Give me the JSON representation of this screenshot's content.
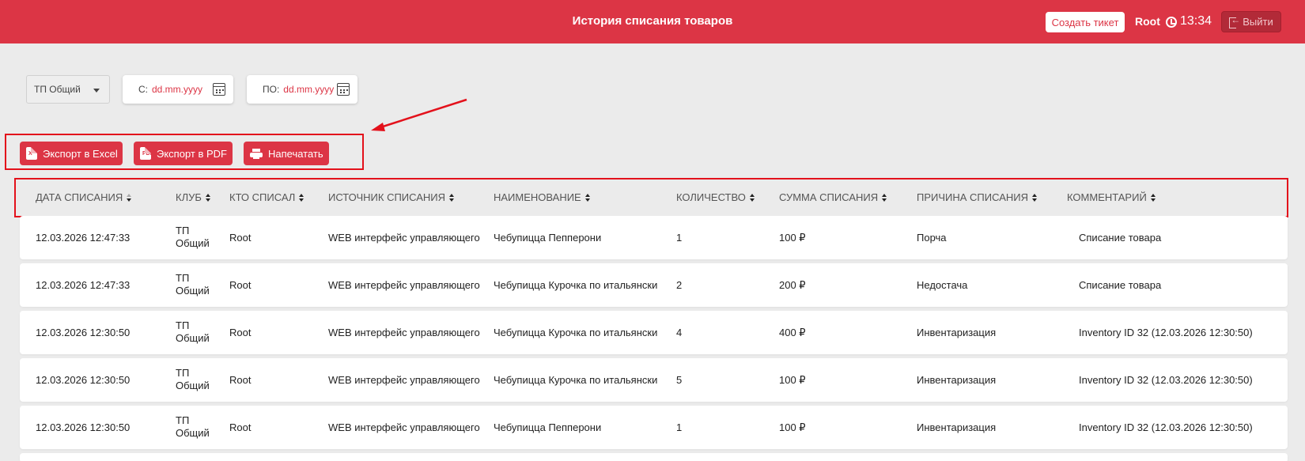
{
  "header": {
    "title": "История списания товаров",
    "create_ticket_label": "Создать тикет",
    "user": "Root",
    "time": "13:34",
    "logout_label": "Выйти"
  },
  "filters": {
    "club_selected": "ТП Общий",
    "from_label": "С:",
    "from_placeholder": "dd.mm.yyyy",
    "to_label": "ПО:",
    "to_placeholder": "dd.mm.yyyy"
  },
  "export": {
    "excel_label": "Экспорт в Excel",
    "pdf_label": "Экспорт в PDF",
    "print_label": "Напечатать"
  },
  "table": {
    "columns": [
      "Дата списания",
      "Клуб",
      "Кто списал",
      "Источник списания",
      "Наименование",
      "Количество",
      "Сумма списания",
      "Причина списания",
      "Комментарий"
    ],
    "rows": [
      [
        "12.03.2026 12:47:33",
        "ТП Общий",
        "Root",
        "WEB интерфейс управляющего",
        "Чебупицца Пепперони",
        "1",
        "100 ₽",
        "Порча",
        "Списание товара"
      ],
      [
        "12.03.2026 12:47:33",
        "ТП Общий",
        "Root",
        "WEB интерфейс управляющего",
        "Чебупицца Курочка по итальянски",
        "2",
        "200 ₽",
        "Недостача",
        "Списание товара"
      ],
      [
        "12.03.2026 12:30:50",
        "ТП Общий",
        "Root",
        "WEB интерфейс управляющего",
        "Чебупицца Курочка по итальянски",
        "4",
        "400 ₽",
        "Инвентаризация",
        "Inventory ID 32 (12.03.2026 12:30:50)"
      ],
      [
        "12.03.2026 12:30:50",
        "ТП Общий",
        "Root",
        "WEB интерфейс управляющего",
        "Чебупицца Курочка по итальянски",
        "5",
        "100 ₽",
        "Инвентаризация",
        "Inventory ID 32 (12.03.2026 12:30:50)"
      ],
      [
        "12.03.2026 12:30:50",
        "ТП Общий",
        "Root",
        "WEB интерфейс управляющего",
        "Чебупицца Пепперони",
        "1",
        "100 ₽",
        "Инвентаризация",
        "Inventory ID 32 (12.03.2026 12:30:50)"
      ]
    ]
  },
  "colors": {
    "brand": "#dc3545",
    "annotation": "#e3111b",
    "background": "#ebebeb"
  }
}
